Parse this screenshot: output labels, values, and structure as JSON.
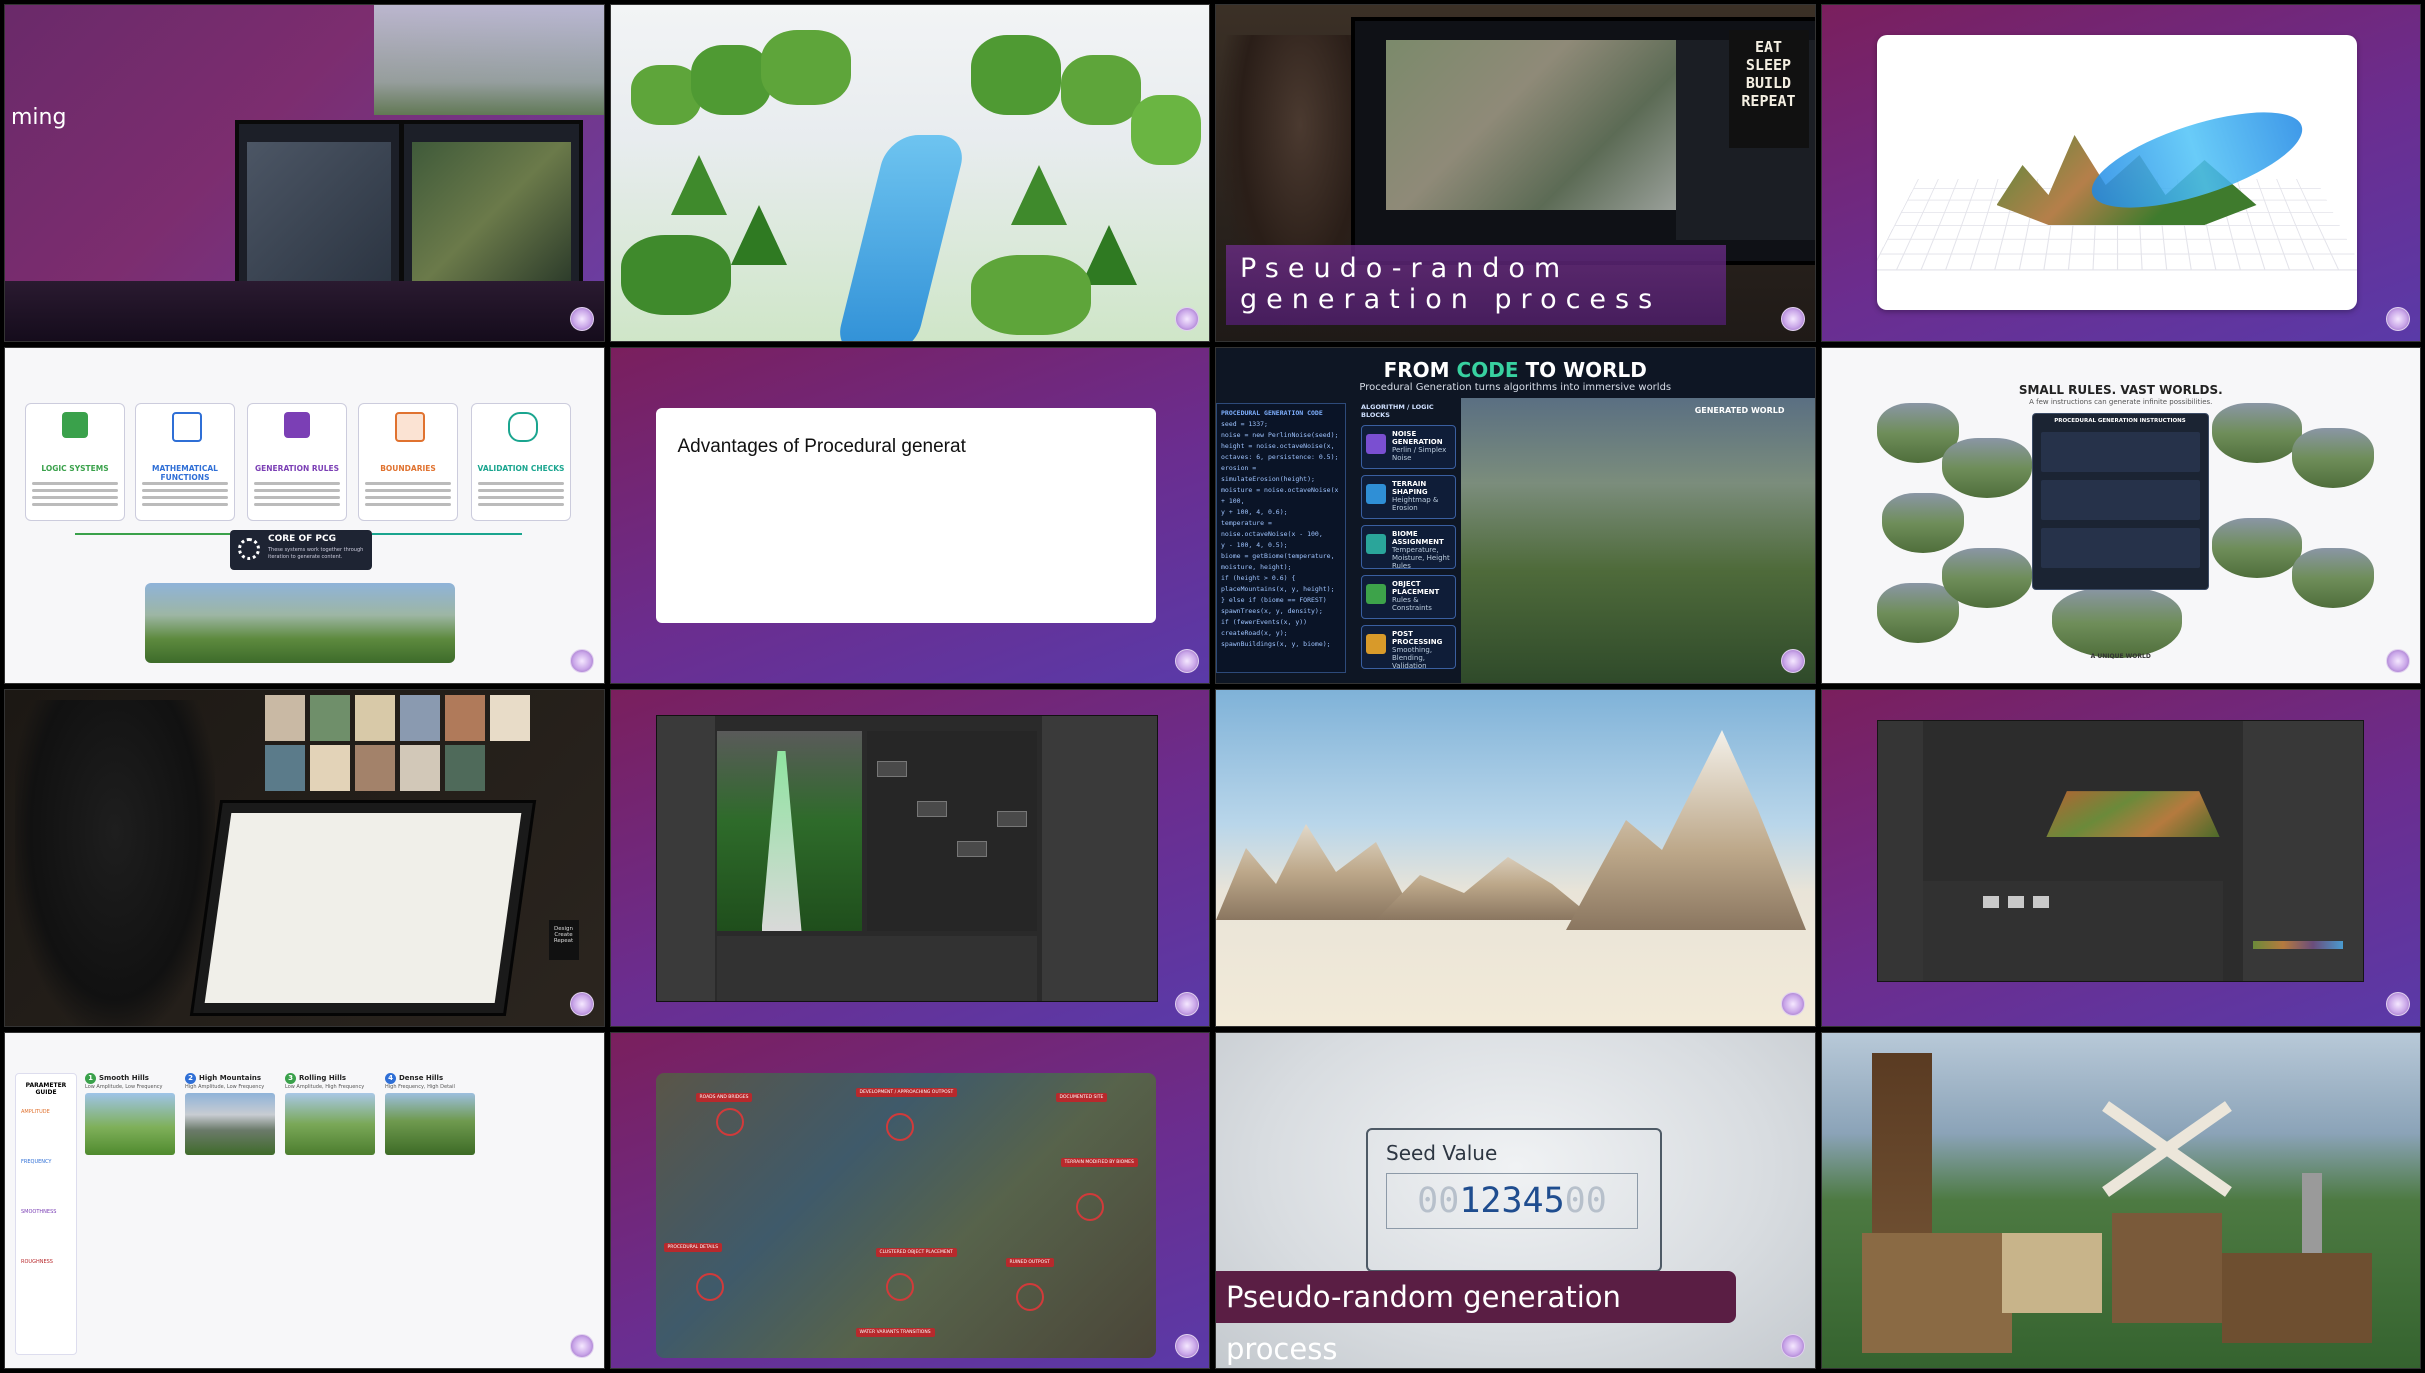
{
  "tiles": [
    {
      "id": 1,
      "caption_text": "ming"
    },
    {
      "id": 2
    },
    {
      "id": 3,
      "poster_text": [
        "EAT",
        "SLEEP",
        "BUILD",
        "REPEAT"
      ],
      "caption_text": "Pseudo-random generation process"
    },
    {
      "id": 4
    },
    {
      "id": 5,
      "boxes": [
        {
          "title": "LOGIC SYSTEMS",
          "icon": "network-icon",
          "color": "#3aa14b"
        },
        {
          "title": "MATHEMATICAL FUNCTIONS",
          "icon": "function-icon",
          "color": "#2f6fd6"
        },
        {
          "title": "GENERATION RULES",
          "icon": "rules-icon",
          "color": "#7b3fb5"
        },
        {
          "title": "BOUNDARIES",
          "icon": "boundary-icon",
          "color": "#e0722f"
        },
        {
          "title": "VALIDATION CHECKS",
          "icon": "shield-check-icon",
          "color": "#1aa58f"
        }
      ],
      "core_title": "CORE OF PCG",
      "core_sub": "These systems work together through iteration to generate content."
    },
    {
      "id": 6,
      "card_text": "Advantages of Procedural generat"
    },
    {
      "id": 7,
      "title_a": "FROM ",
      "title_b": "CODE",
      "title_c": " TO WORLD",
      "subtitle": "Procedural Generation turns algorithms into immersive worlds",
      "code_header": "PROCEDURAL GENERATION CODE",
      "code_lines": [
        "seed = 1337;",
        "noise = new PerlinNoise(seed);",
        "height = noise.octaveNoise(x,",
        "  octaves: 6, persistence: 0.5);",
        "erosion = simulateErosion(height);",
        "moisture = noise.octaveNoise(x + 100,",
        "  y + 100, 4, 0.6);",
        "temperature = noise.octaveNoise(x - 100,",
        "  y - 100, 4, 0.5);",
        "biome = getBiome(temperature,",
        "  moisture, height);",
        "if (height > 0.6) {",
        "  placeMountains(x, y, height);",
        "} else if (biome == FOREST)",
        "  spawnTrees(x, y, density);",
        "if (fewerEvents(x, y))",
        "  createRoad(x, y);",
        "spawnBuildings(x, y, biome);"
      ],
      "blocks_header": "ALGORITHM / LOGIC BLOCKS",
      "blocks": [
        {
          "title": "NOISE GENERATION",
          "sub": "Perlin / Simplex Noise",
          "color": "#7a4fd1"
        },
        {
          "title": "TERRAIN SHAPING",
          "sub": "Heightmap & Erosion",
          "color": "#2f8fd6"
        },
        {
          "title": "BIOME ASSIGNMENT",
          "sub": "Temperature, Moisture, Height Rules",
          "color": "#2aa59a"
        },
        {
          "title": "OBJECT PLACEMENT",
          "sub": "Rules & Constraints",
          "color": "#3da34a"
        },
        {
          "title": "POST PROCESSING",
          "sub": "Smoothing, Blending, Validation",
          "color": "#d89a2a"
        }
      ],
      "world_label": "GENERATED WORLD"
    },
    {
      "id": 8,
      "title": "SMALL RULES. VAST WORLDS.",
      "subtitle": "A few instructions can generate infinite possibilities.",
      "panel_title": "PROCEDURAL GENERATION INSTRUCTIONS",
      "footer": "A UNIQUE WORLD"
    },
    {
      "id": 9,
      "mug_text": "Design Create Repeat"
    },
    {
      "id": 10
    },
    {
      "id": 11
    },
    {
      "id": 12
    },
    {
      "id": 13,
      "side_title": "PARAMETER GUIDE",
      "side_items": [
        "AMPLITUDE",
        "FREQUENCY",
        "SMOOTHNESS",
        "ROUGHNESS"
      ],
      "columns": [
        {
          "num": "1",
          "title": "Smooth Hills",
          "sub": "Low Amplitude, Low Frequency",
          "color": "#3aa14b"
        },
        {
          "num": "2",
          "title": "High Mountains",
          "sub": "High Amplitude, Low Frequency",
          "color": "#2f6fd6"
        },
        {
          "num": "3",
          "title": "Rolling Hills",
          "sub": "Low Amplitude, High Frequency",
          "color": "#3aa14b"
        },
        {
          "num": "4",
          "title": "Dense Hills",
          "sub": "High Frequency, High Detail",
          "color": "#2f6fd6"
        }
      ]
    },
    {
      "id": 14,
      "labels": [
        "ROADS AND BRIDGES",
        "DEVELOPMENT / APPROACHING OUTPOST",
        "DOCUMENTED SITE",
        "TERRAIN MODIFIED BY BIOMES",
        "PROCEDURAL DETAILS",
        "CLUSTERED OBJECT PLACEMENT",
        "RUINED OUTPOST",
        "WATER VARIANTS TRANSITIONS"
      ]
    },
    {
      "id": 15,
      "seed_label": "Seed Value",
      "seed_prefix": "00",
      "seed_value": "12345",
      "seed_suffix": "00",
      "caption_text": "Pseudo-random generation process"
    },
    {
      "id": 16
    }
  ]
}
